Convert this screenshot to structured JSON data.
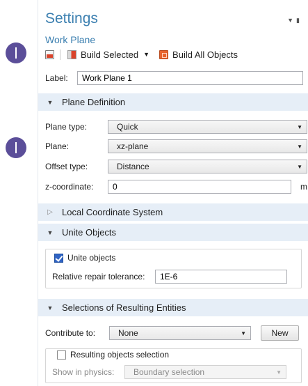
{
  "window": {
    "title": "Settings",
    "subtitle": "Work Plane"
  },
  "toolbar": {
    "build_selected_label": "Build Selected",
    "build_all_label": "Build All Objects"
  },
  "label_field": {
    "label": "Label:",
    "value": "Work Plane 1"
  },
  "sections": {
    "plane_definition": "Plane Definition",
    "local_coordinate_system": "Local Coordinate System",
    "unite_objects": "Unite Objects",
    "selections": "Selections of Resulting Entities"
  },
  "plane_definition": {
    "plane_type_label": "Plane type:",
    "plane_type_value": "Quick",
    "plane_label": "Plane:",
    "plane_value": "xz-plane",
    "offset_type_label": "Offset type:",
    "offset_type_value": "Distance",
    "zcoord_label": "z-coordinate:",
    "zcoord_value": "0",
    "zcoord_unit": "m"
  },
  "unite_objects": {
    "checkbox_label": "Unite objects",
    "checked": true,
    "tolerance_label": "Relative repair tolerance:",
    "tolerance_value": "1E-6"
  },
  "selections": {
    "contribute_label": "Contribute to:",
    "contribute_value": "None",
    "new_button": "New",
    "resulting_checkbox_label": "Resulting objects selection",
    "resulting_checked": false,
    "show_in_physics_label": "Show in physics:",
    "show_in_physics_value": "Boundary selection"
  },
  "colors": {
    "title_blue": "#3b7fb0",
    "section_bg": "#e6eef7",
    "marker": "#5b4e99"
  }
}
